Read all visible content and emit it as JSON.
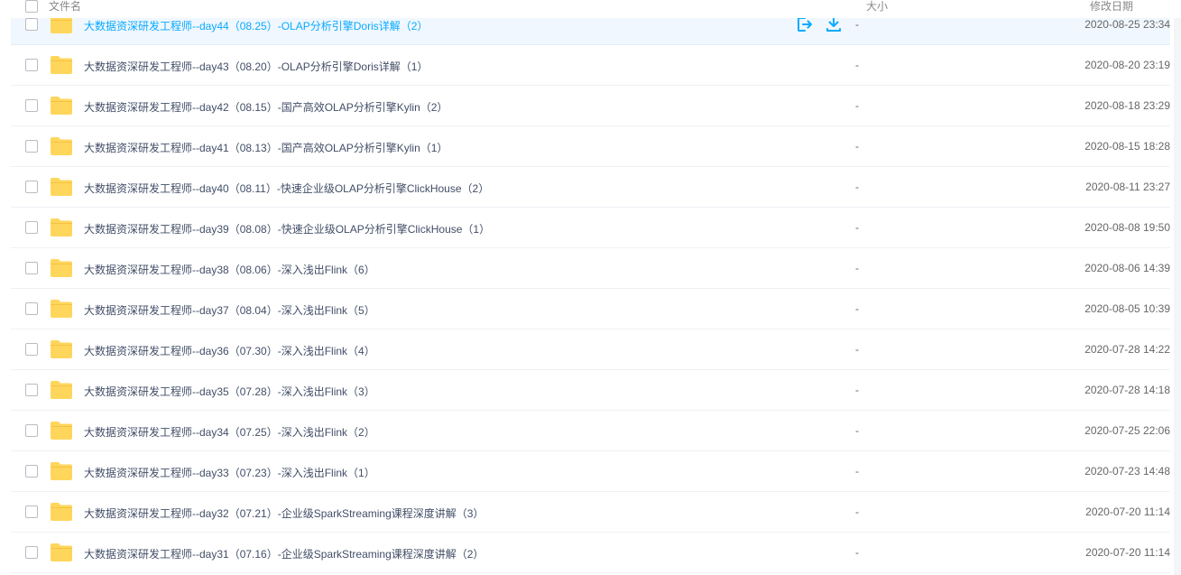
{
  "header": {
    "name_label": "文件名",
    "size_label": "大小",
    "date_label": "修改日期"
  },
  "colors": {
    "accent": "#09aaff",
    "folder": "#ffd65c",
    "row_hover_bg": "#f0f7fe"
  },
  "rows": [
    {
      "name": "大数据资深研发工程师--day44（08.25）-OLAP分析引擎Doris详解（2）",
      "size": "-",
      "date": "2020-08-25 23:34"
    },
    {
      "name": "大数据资深研发工程师--day43（08.20）-OLAP分析引擎Doris详解（1）",
      "size": "-",
      "date": "2020-08-20 23:19"
    },
    {
      "name": "大数据资深研发工程师--day42（08.15）-国产高效OLAP分析引擎Kylin（2）",
      "size": "-",
      "date": "2020-08-18 23:29"
    },
    {
      "name": "大数据资深研发工程师--day41（08.13）-国产高效OLAP分析引擎Kylin（1）",
      "size": "-",
      "date": "2020-08-15 18:28"
    },
    {
      "name": "大数据资深研发工程师--day40（08.11）-快速企业级OLAP分析引擎ClickHouse（2）",
      "size": "-",
      "date": "2020-08-11 23:27"
    },
    {
      "name": "大数据资深研发工程师--day39（08.08）-快速企业级OLAP分析引擎ClickHouse（1）",
      "size": "-",
      "date": "2020-08-08 19:50"
    },
    {
      "name": "大数据资深研发工程师--day38（08.06）-深入浅出Flink（6）",
      "size": "-",
      "date": "2020-08-06 14:39"
    },
    {
      "name": "大数据资深研发工程师--day37（08.04）-深入浅出Flink（5）",
      "size": "-",
      "date": "2020-08-05 10:39"
    },
    {
      "name": "大数据资深研发工程师--day36（07.30）-深入浅出Flink（4）",
      "size": "-",
      "date": "2020-07-28 14:22"
    },
    {
      "name": "大数据资深研发工程师--day35（07.28）-深入浅出Flink（3）",
      "size": "-",
      "date": "2020-07-28 14:18"
    },
    {
      "name": "大数据资深研发工程师--day34（07.25）-深入浅出Flink（2）",
      "size": "-",
      "date": "2020-07-25 22:06"
    },
    {
      "name": "大数据资深研发工程师--day33（07.23）-深入浅出Flink（1）",
      "size": "-",
      "date": "2020-07-23 14:48"
    },
    {
      "name": "大数据资深研发工程师--day32（07.21）-企业级SparkStreaming课程深度讲解（3）",
      "size": "-",
      "date": "2020-07-20 11:14"
    },
    {
      "name": "大数据资深研发工程师--day31（07.16）-企业级SparkStreaming课程深度讲解（2）",
      "size": "-",
      "date": "2020-07-20 11:14"
    }
  ]
}
